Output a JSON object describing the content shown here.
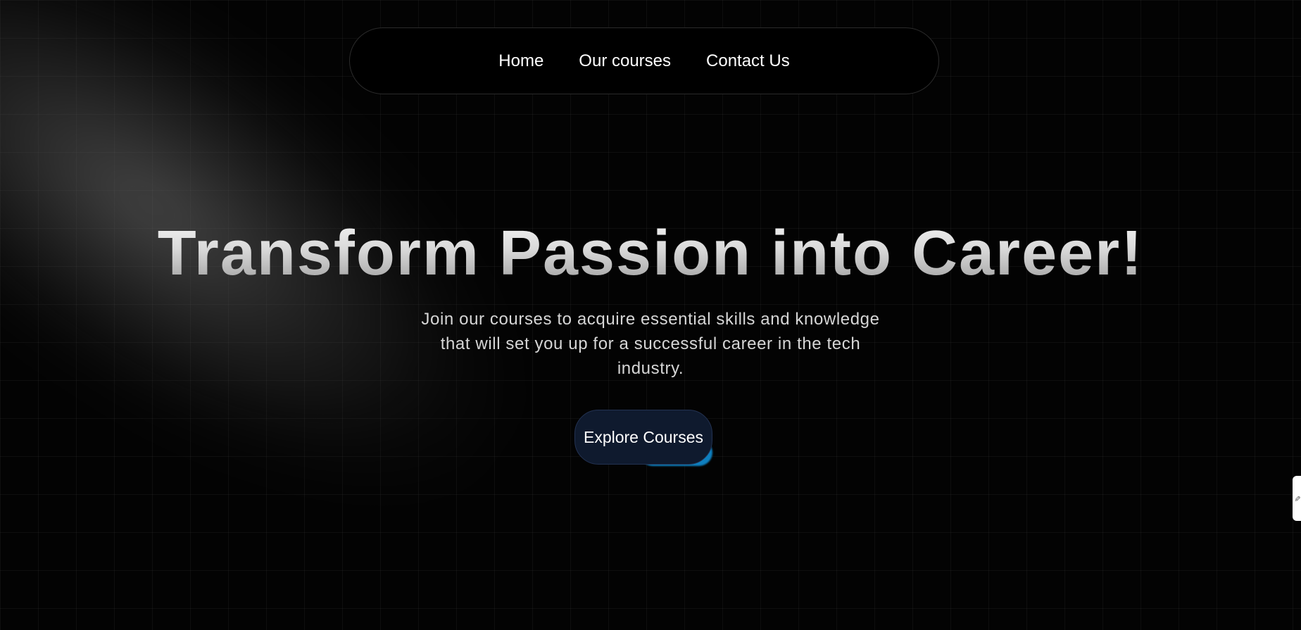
{
  "nav": {
    "items": [
      {
        "label": "Home"
      },
      {
        "label": "Our courses"
      },
      {
        "label": "Contact Us"
      }
    ]
  },
  "hero": {
    "title": "Transform Passion into Career!",
    "subtitle": "Join our courses to acquire essential skills and knowledge that will set you up for a successful career in the tech industry.",
    "cta_label": "Explore Courses"
  },
  "side_tab": {
    "icon": "chat-bubble-icon"
  },
  "colors": {
    "background": "#030303",
    "navbar_bg": "#000000",
    "cta_bg": "#0f1a2e",
    "cta_glow": "#0e7fbf",
    "text": "#ffffff"
  }
}
